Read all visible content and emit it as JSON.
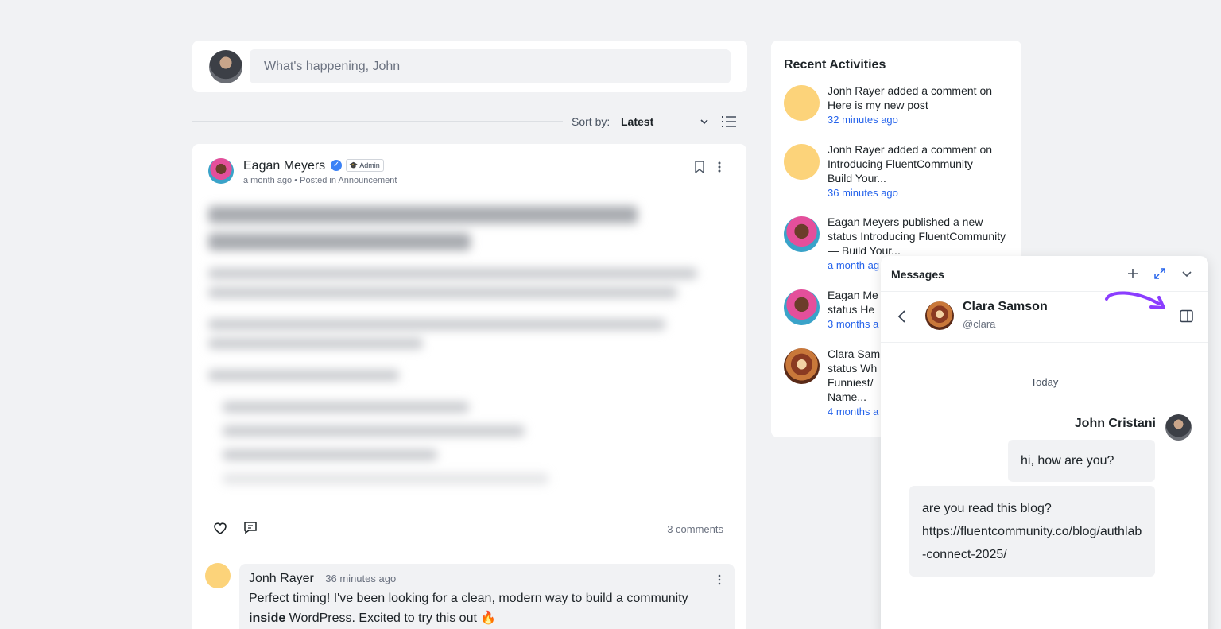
{
  "composer": {
    "placeholder": "What's happening, John"
  },
  "sort": {
    "label": "Sort by:",
    "value": "Latest"
  },
  "post": {
    "author": "Eagan Meyers",
    "badge": "Admin",
    "meta": "a month ago • Posted in Announcement",
    "comments_count": "3 comments"
  },
  "comment": {
    "author": "Jonh Rayer",
    "time": "36 minutes ago",
    "text_before": "Perfect timing! I've been looking for a clean, modern way to build a community ",
    "text_bold": "inside",
    "text_after": " WordPress. Excited to try this out 🔥"
  },
  "activities": {
    "title": "Recent Activities",
    "items": [
      {
        "text": "Jonh Rayer added a comment on Here is my new post",
        "time": "32 minutes ago"
      },
      {
        "text": "Jonh Rayer added a comment on Introducing FluentCommunity — Build Your...",
        "time": "36 minutes ago"
      },
      {
        "text": "Eagan Meyers published a new status Introducing FluentCommunity — Build Your...",
        "time": "a month ag"
      },
      {
        "text": "Eagan Me status He",
        "time": "3 months a"
      },
      {
        "text": "Clara Sam status Wh Funniest/ Name...",
        "time": "4 months a"
      }
    ]
  },
  "messages": {
    "title": "Messages",
    "contact_name": "Clara Samson",
    "contact_handle": "@clara",
    "day": "Today",
    "sender": "John Cristani",
    "bubble1": "hi, how are you?",
    "bubble2_line1": "are you read this blog?",
    "bubble2_line2": "https://fluentcommunity.co/blog/authlab-connect-2025/"
  }
}
